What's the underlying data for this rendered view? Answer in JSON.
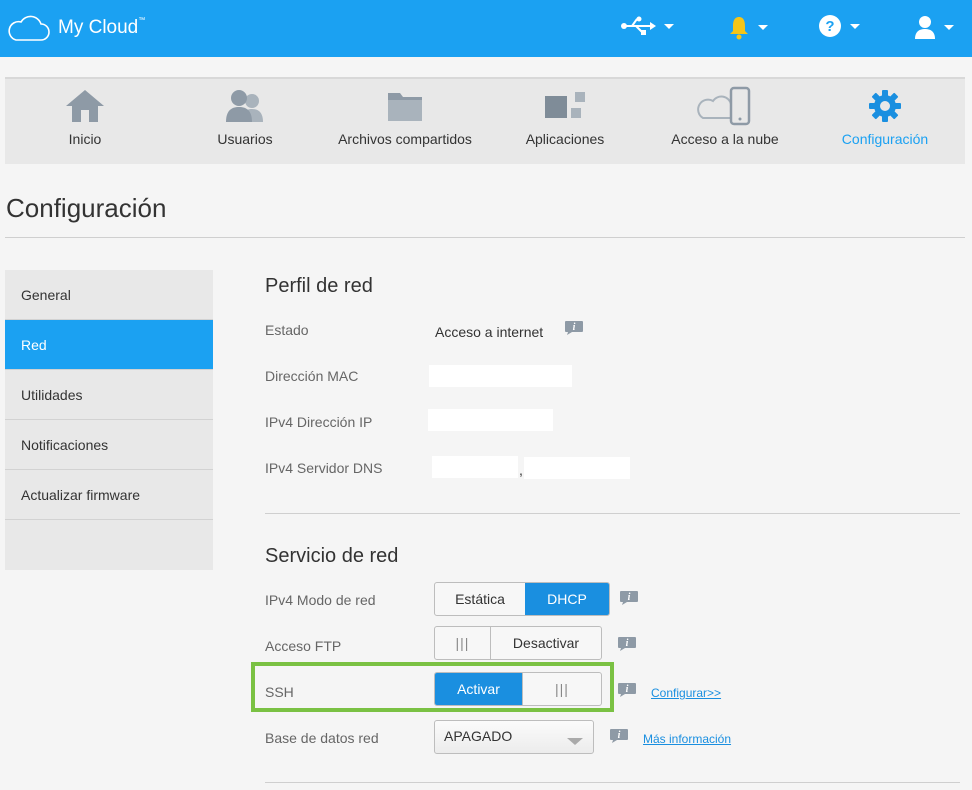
{
  "app": {
    "title": "My Cloud",
    "tm": "™"
  },
  "topbar": {
    "icons": [
      "usb-icon",
      "bell-icon",
      "help-icon",
      "user-icon"
    ],
    "bell_color": "#f5c518"
  },
  "nav": {
    "items": [
      {
        "label": "Inicio",
        "icon": "home-icon"
      },
      {
        "label": "Usuarios",
        "icon": "users-icon"
      },
      {
        "label": "Archivos compartidos",
        "icon": "folder-icon"
      },
      {
        "label": "Aplicaciones",
        "icon": "apps-icon"
      },
      {
        "label": "Acceso a la nube",
        "icon": "cloud-device-icon"
      },
      {
        "label": "Configuración",
        "icon": "gear-icon",
        "active": true
      }
    ]
  },
  "page": {
    "title": "Configuración"
  },
  "sidebar": {
    "items": [
      {
        "label": "General"
      },
      {
        "label": "Red",
        "active": true
      },
      {
        "label": "Utilidades"
      },
      {
        "label": "Notificaciones"
      },
      {
        "label": "Actualizar firmware"
      }
    ]
  },
  "profile": {
    "title": "Perfil de red",
    "status_label": "Estado",
    "status_value": "Acceso a internet",
    "mac_label": "Dirección MAC",
    "ip_label": "IPv4 Dirección IP",
    "dns_label": "IPv4 Servidor DNS",
    "dns_separator": ","
  },
  "service": {
    "title": "Servicio de red",
    "mode_label": "IPv4 Modo de red",
    "mode_static": "Estática",
    "mode_dhcp": "DHCP",
    "ftp_label": "Acceso FTP",
    "ftp_grip": "|||",
    "ftp_state": "Desactivar",
    "ssh_label": "SSH",
    "ssh_state": "Activar",
    "ssh_grip": "|||",
    "ssh_link": "Configurar>>",
    "db_label": "Base de datos red",
    "db_value": "APAGADO",
    "db_link": "Más información"
  },
  "colors": {
    "accent": "#1ba1f2",
    "highlight": "#7ac143"
  }
}
